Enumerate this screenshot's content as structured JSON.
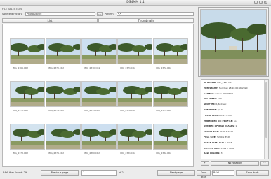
{
  "window": {
    "title": "DS4MM 1.1"
  },
  "file_selection": {
    "label": "FILE SELECTION",
    "source_label": "Source directory",
    "source_value": "Photos/BMM",
    "browse_label": "…",
    "pattern_label": "Pattern",
    "pattern_value": "*.*"
  },
  "tabs": [
    {
      "label": "List"
    },
    {
      "label": "Thumbnails"
    }
  ],
  "thumbnails": [
    {
      "caption": "IMG_4369.CR2"
    },
    {
      "caption": "IMG_4370.CR2"
    },
    {
      "caption": "IMG_4370_CR2"
    },
    {
      "caption": "IMG_4371.CR2"
    },
    {
      "caption": "IMG_4372.CR2"
    },
    {
      "caption": "IMG_4373.CR2"
    },
    {
      "caption": "IMG_4374.CR2"
    },
    {
      "caption": "IMG_4375.CR2"
    },
    {
      "caption": "IMG_4376.CR2"
    },
    {
      "caption": "IMG_4377.CR2"
    },
    {
      "caption": "IMG_4378.CR2"
    },
    {
      "caption": "IMG_4379.CR2"
    },
    {
      "caption": "IMG_4380.CR2"
    },
    {
      "caption": "IMG_4381.CR2"
    },
    {
      "caption": "IMG_4382.CR2"
    }
  ],
  "info": [
    {
      "key": "FILENAME:",
      "value": "IMG_4370.CR2"
    },
    {
      "key": "TIMESTAMP:",
      "value": "Sun May 28 18:00:16 2020"
    },
    {
      "key": "CAMERA:",
      "value": "Canon EOS 650D"
    },
    {
      "key": "ISO SPEED:",
      "value": "100"
    },
    {
      "key": "SHUTTER:",
      "value": "1/640 sec"
    },
    {
      "key": "APERTURE:",
      "value": "f/4.0"
    },
    {
      "key": "FOCAL LENGTH:",
      "value": "17.0 mm"
    },
    {
      "key": "EMBEDDED ICC PROFILE:",
      "value": "no"
    },
    {
      "key": "NUMBER OF RAW IMAGES:",
      "value": "1"
    },
    {
      "key": "THUMB SIZE:",
      "value": "5184 x 3456"
    },
    {
      "key": "FULL SIZE:",
      "value": "5280 x 3528"
    },
    {
      "key": "IMAGE SIZE:",
      "value": "5184 x 3456"
    },
    {
      "key": "OUTPUT SIZE:",
      "value": "5184 x 3456"
    },
    {
      "key": "RAW COLORS:",
      "value": "3"
    }
  ],
  "rotation": {
    "left_label": "↶",
    "none_label": "No rotation",
    "right_label": "↷"
  },
  "bottom": {
    "status": "RAW files found: 29",
    "prev_label": "Previous page",
    "page_value": "1",
    "of_text": "of 2",
    "next_label": "Next page",
    "save_label": "Save draft",
    "format_value": "RAW",
    "save2_label": "Save draft"
  }
}
